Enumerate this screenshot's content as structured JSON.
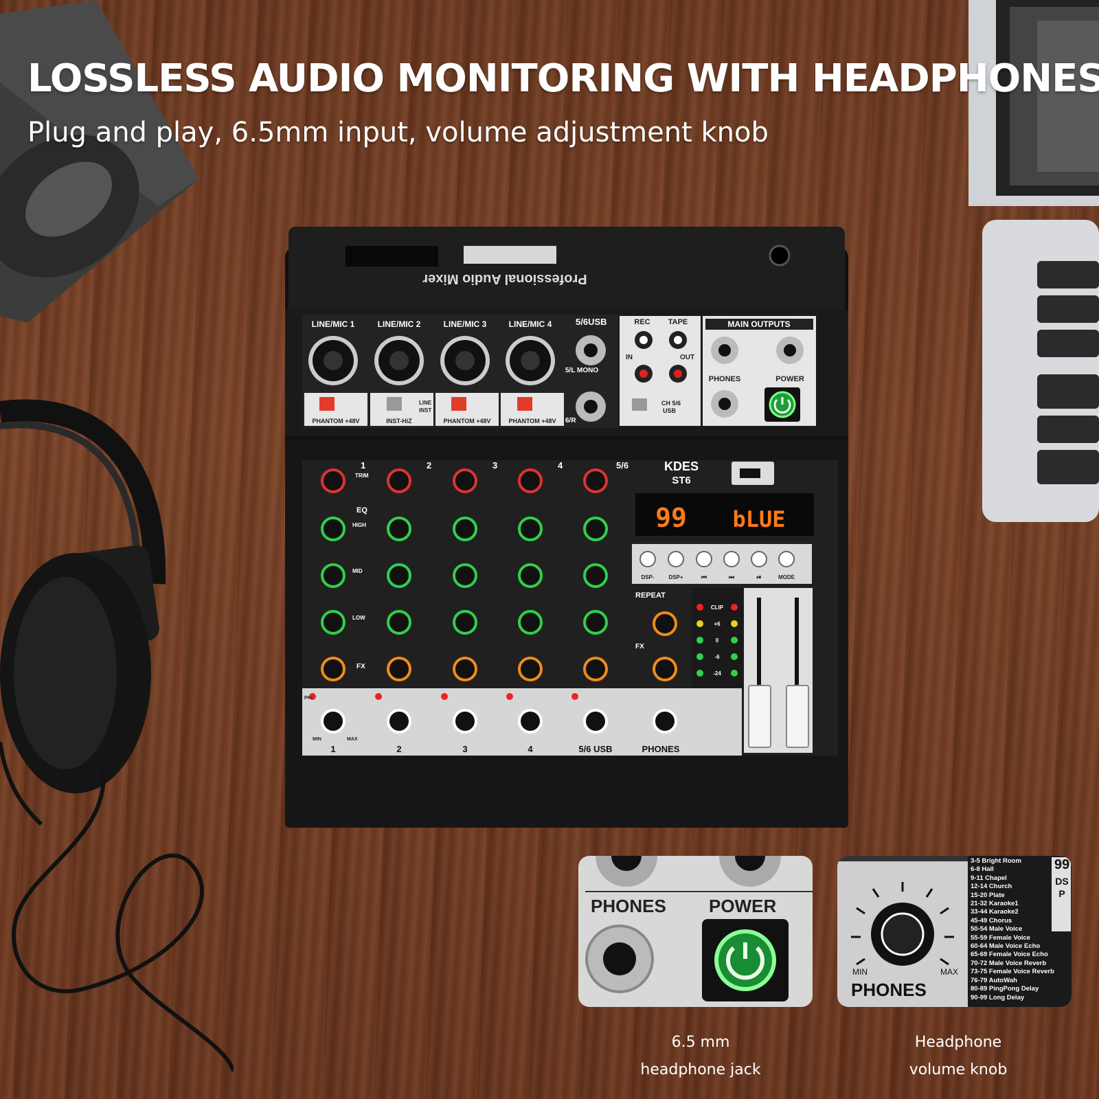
{
  "headline": "LOSSLESS AUDIO MONITORING WITH HEADPHONES",
  "subline": "Plug and play, 6.5mm input, volume adjustment knob",
  "mixer": {
    "top_label": "Professional Audio Mixer",
    "inputs": [
      "LINE/MIC 1",
      "LINE/MIC 2",
      "LINE/MIC 3",
      "LINE/MIC 4"
    ],
    "usb_input": "5/6USB",
    "mono_label": "5/L MONO",
    "right_label": "6/R",
    "rec_label": "REC",
    "tape_label": "TAPE",
    "in_label": "IN",
    "out_label": "OUT",
    "main_outputs": "MAIN OUTPUTS",
    "phones": "PHONES",
    "power": "POWER",
    "phantom": "PHANTOM +48V",
    "inst_hiz": "INST-HiZ",
    "line": "LINE",
    "inst": "INST",
    "ch56_usb": "CH 5/6",
    "usb": "USB",
    "brand": "KDES",
    "model": "ST6",
    "display_left": "99",
    "display_right": "bLUE",
    "channel_numbers": [
      "1",
      "2",
      "3",
      "4",
      "5/6"
    ],
    "bottom_labels": [
      "1",
      "2",
      "3",
      "4",
      "5/6 USB",
      "PHONES"
    ],
    "trim": "TRIM",
    "eq": "EQ",
    "high": "HIGH",
    "mid": "MID",
    "low": "LOW",
    "fx": "FX",
    "repeat": "REPEAT",
    "buttons": [
      "DSP-",
      "DSP+",
      "⏮",
      "⏭",
      "⏯",
      "MODE"
    ],
    "meter_labels": [
      "CLIP",
      "+6",
      "0",
      "-6",
      "-24"
    ],
    "min": "MIN",
    "max": "MAX",
    "pk": "PK!"
  },
  "inset_left": {
    "phones": "PHONES",
    "power": "POWER"
  },
  "inset_right": {
    "phones": "PHONES",
    "min": "MIN",
    "max": "MAX",
    "dsp_badge": "99",
    "dsp_text": "DSP",
    "presets": [
      "3-5 Bright Room",
      "6-8 Hall",
      "9-11 Chapel",
      "12-14 Church",
      "15-20 Plate",
      "21-32 Karaoke1",
      "33-44 Karaoke2",
      "45-49 Chorus",
      "50-54 Male Voice",
      "55-59 Female Voice",
      "60-64 Male Voice Echo",
      "65-69 Female Voice Echo",
      "70-72 Male Voice Reverb",
      "73-75 Female Voice Reverb",
      "76-79 AutoWah",
      "80-89 PingPong Delay",
      "90-99 Long Delay"
    ]
  },
  "captions": {
    "left": [
      "6.5 mm",
      "headphone jack"
    ],
    "right": [
      "Headphone",
      "volume knob"
    ]
  }
}
